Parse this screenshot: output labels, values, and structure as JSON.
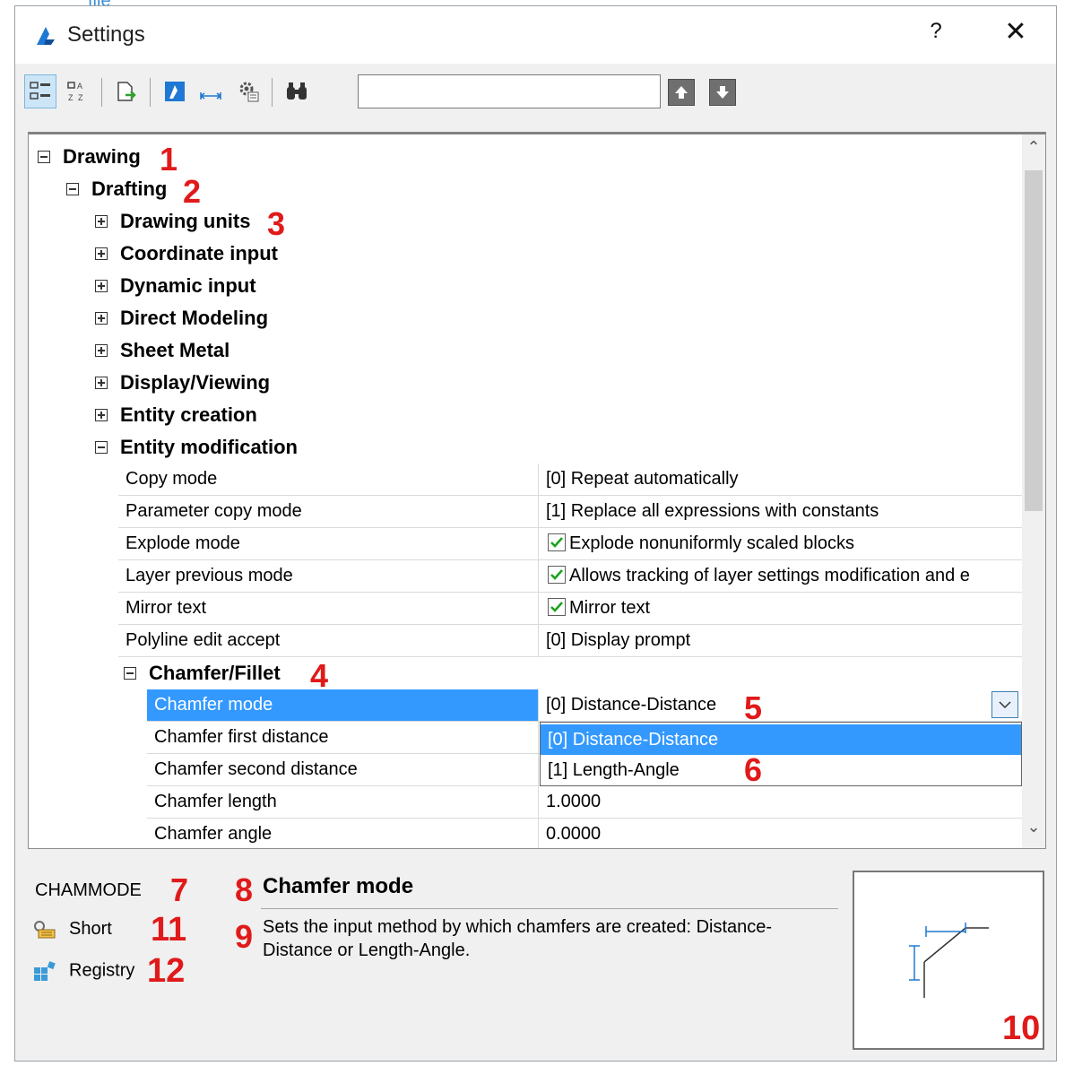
{
  "top_link": "file",
  "window": {
    "title": "Settings",
    "help": "?",
    "close": "✕"
  },
  "toolbar": {
    "search_value": ""
  },
  "tree": {
    "root": "Drawing",
    "child": "Drafting",
    "sections": [
      "Drawing units",
      "Coordinate input",
      "Dynamic input",
      "Direct Modeling",
      "Sheet Metal",
      "Display/Viewing",
      "Entity creation"
    ],
    "expanded_section": "Entity modification",
    "rows": [
      {
        "name": "Copy mode",
        "value": "[0] Repeat automatically"
      },
      {
        "name": "Parameter copy mode",
        "value": "[1] Replace all expressions with constants"
      },
      {
        "name": "Explode mode",
        "value": "Explode nonuniformly scaled blocks"
      },
      {
        "name": "Layer previous mode",
        "value": "Allows tracking of layer settings modification and e"
      },
      {
        "name": "Mirror text",
        "value": "Mirror text"
      },
      {
        "name": "Polyline edit accept",
        "value": "[0] Display prompt"
      }
    ],
    "subsection": "Chamfer/Fillet",
    "sub_rows": [
      {
        "name": "Chamfer mode",
        "value": "[0] Distance-Distance"
      },
      {
        "name": "Chamfer first distance",
        "value": ""
      },
      {
        "name": "Chamfer second distance",
        "value": ""
      },
      {
        "name": "Chamfer length",
        "value": "1.0000"
      },
      {
        "name": "Chamfer angle",
        "value": "0.0000"
      }
    ],
    "dropdown_options": [
      "[0] Distance-Distance",
      "[1] Length-Angle"
    ]
  },
  "details": {
    "variable": "CHAMMODE",
    "short_label": "Short",
    "registry_label": "Registry",
    "title": "Chamfer mode",
    "description": "Sets the input method by which chamfers are created: Distance-Distance or Length-Angle."
  },
  "annotations": [
    "1",
    "2",
    "3",
    "4",
    "5",
    "6",
    "7",
    "8",
    "9",
    "10",
    "11",
    "12"
  ],
  "colors": {
    "selection": "#3399ff",
    "annotation": "#e01a1a",
    "check": "#1aa31a"
  }
}
